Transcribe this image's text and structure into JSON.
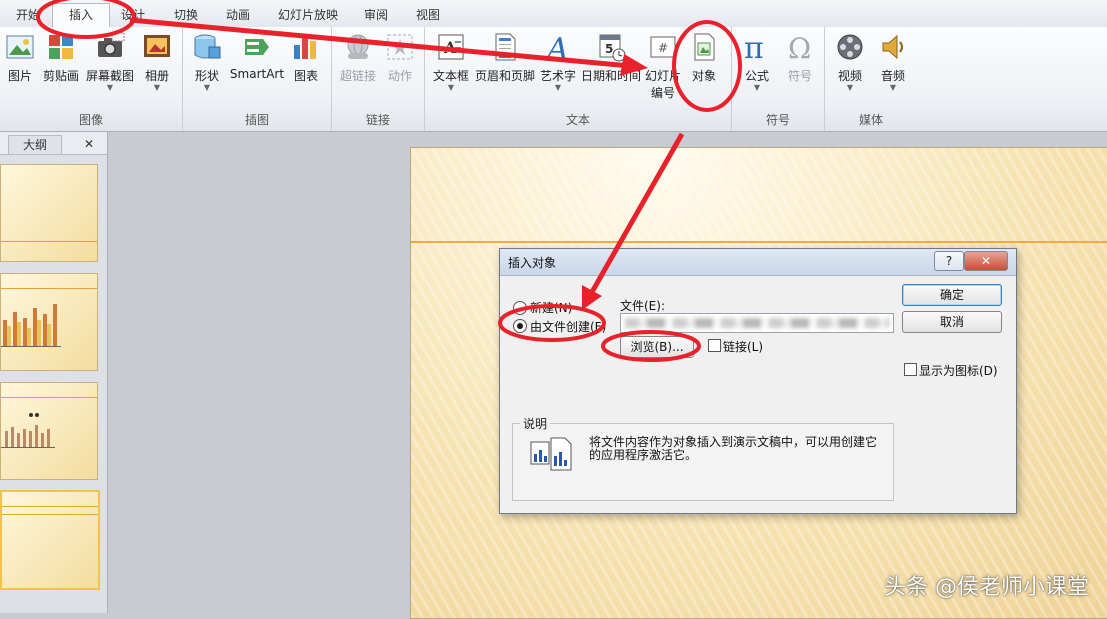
{
  "tabs": [
    "开始",
    "插入",
    "设计",
    "切换",
    "动画",
    "幻灯片放映",
    "审阅",
    "视图"
  ],
  "active_tab": "插入",
  "ribbon": {
    "groups": {
      "images": "图像",
      "illustrations": "插图",
      "links": "链接",
      "text": "文本",
      "symbols": "符号",
      "media": "媒体"
    },
    "buttons": {
      "picture": "图片",
      "clipart": "剪贴画",
      "screenshot": "屏幕截图",
      "album": "相册",
      "shapes": "形状",
      "smartart": "SmartArt",
      "chart": "图表",
      "hyperlink": "超链接",
      "action": "动作",
      "textbox": "文本框",
      "header_footer": "页眉和页脚",
      "wordart": "艺术字",
      "datetime": "日期和时间",
      "slide_number_1": "幻灯片",
      "slide_number_2": "编号",
      "object": "对象",
      "equation": "公式",
      "symbol": "符号",
      "video": "视频",
      "audio": "音频"
    },
    "icon_glyphs": {
      "equation": "π",
      "symbol": "Ω",
      "wordart": "A",
      "datetime": "5",
      "slide_number": "#"
    }
  },
  "left_panel": {
    "tab_outline": "大纲",
    "close": "✕"
  },
  "dialog": {
    "title": "插入对象",
    "help": "?",
    "close": "✕",
    "radio_new": "新建(N)",
    "radio_from_file": "由文件创建(F)",
    "file_label": "文件(E):",
    "browse": "浏览(B)...",
    "link": "链接(L)",
    "ok": "确定",
    "cancel": "取消",
    "show_as_icon": "显示为图标(D)",
    "description_label": "说明",
    "description_text": "将文件内容作为对象插入到演示文稿中，可以用创建它的应用程序激活它。"
  },
  "watermark": "头条 @侯老师小课堂",
  "colors": {
    "annotation": "#e8212b",
    "slide_accent": "#efad3f"
  }
}
